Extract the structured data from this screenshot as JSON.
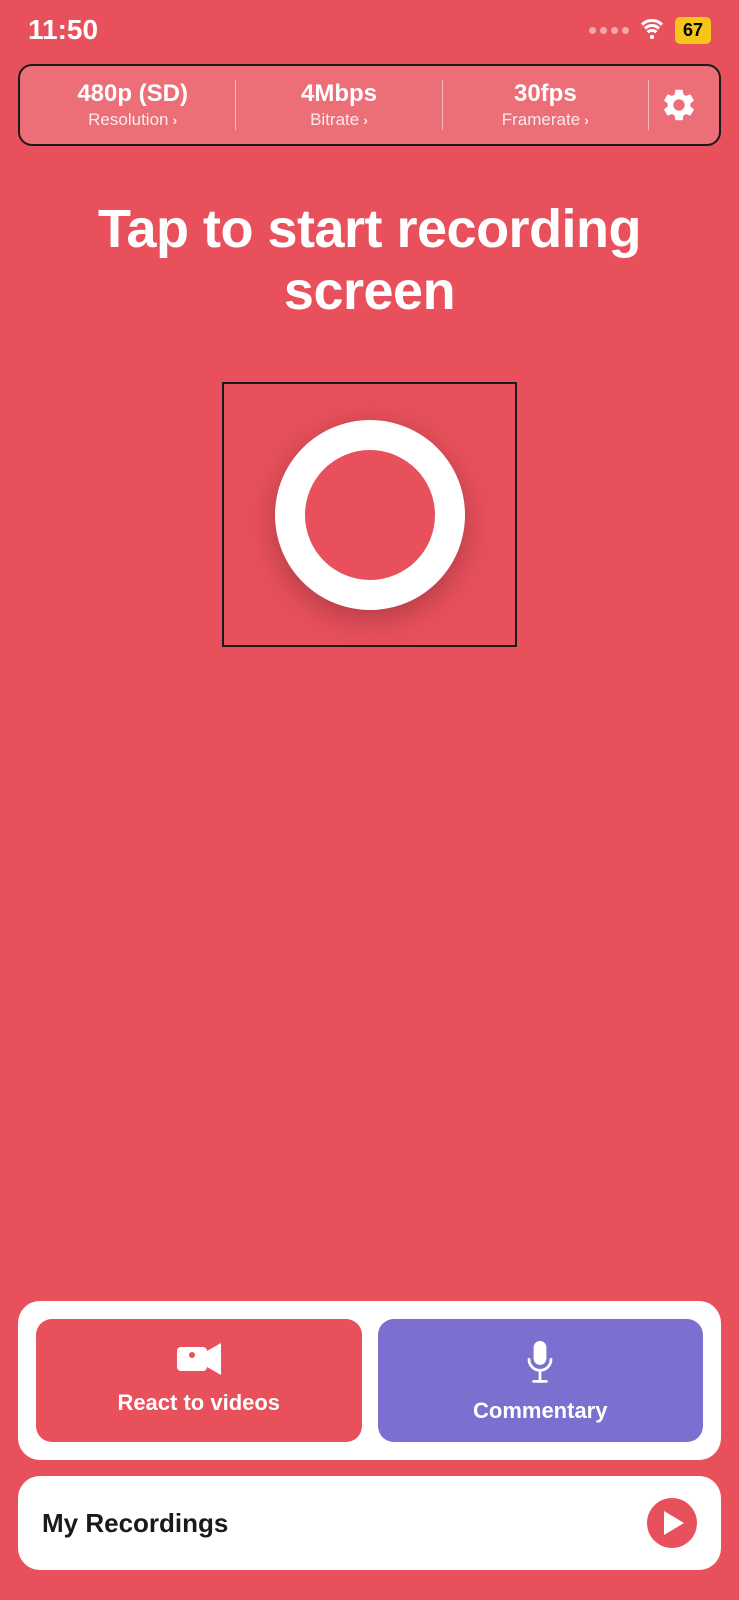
{
  "statusBar": {
    "time": "11:50",
    "battery": "67"
  },
  "settingsBar": {
    "resolution": {
      "value": "480p (SD)",
      "label": "Resolution"
    },
    "bitrate": {
      "value": "4Mbps",
      "label": "Bitrate"
    },
    "framerate": {
      "value": "30fps",
      "label": "Framerate"
    }
  },
  "mainHeading": "Tap to start recording screen",
  "actions": {
    "reactLabel": "React to videos",
    "commentaryLabel": "Commentary"
  },
  "recordings": {
    "label": "My Recordings"
  }
}
